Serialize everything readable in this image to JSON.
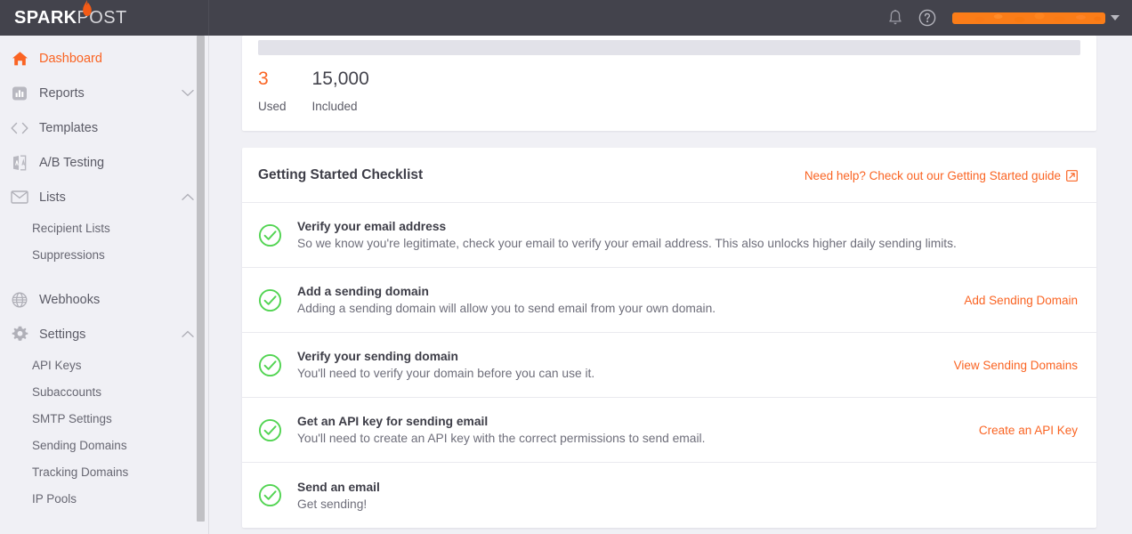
{
  "brand": {
    "logo_spark": "SPARK",
    "logo_post": "POST",
    "accent_color": "#fa6423",
    "topbar_color": "#43434c",
    "success_color": "#52d452"
  },
  "topbar": {
    "notifications_icon": "bell-icon",
    "help_icon": "help-circle-icon",
    "user_name": "",
    "user_caret_icon": "chevron-down-icon"
  },
  "sidebar": {
    "items": [
      {
        "label": "Dashboard",
        "icon": "home-icon",
        "active": true,
        "expandable": false
      },
      {
        "label": "Reports",
        "icon": "bar-chart-icon",
        "active": false,
        "expandable": true,
        "expanded": false
      },
      {
        "label": "Templates",
        "icon": "code-icon",
        "active": false,
        "expandable": false
      },
      {
        "label": "A/B Testing",
        "icon": "ab-test-icon",
        "active": false,
        "expandable": false
      },
      {
        "label": "Lists",
        "icon": "envelope-icon",
        "active": false,
        "expandable": true,
        "expanded": true
      }
    ],
    "lists_children": [
      {
        "label": "Recipient Lists"
      },
      {
        "label": "Suppressions"
      }
    ],
    "items2": [
      {
        "label": "Webhooks",
        "icon": "globe-icon",
        "active": false,
        "expandable": false
      },
      {
        "label": "Settings",
        "icon": "gear-icon",
        "active": false,
        "expandable": true,
        "expanded": true
      }
    ],
    "settings_children": [
      {
        "label": "API Keys"
      },
      {
        "label": "Subaccounts"
      },
      {
        "label": "SMTP Settings"
      },
      {
        "label": "Sending Domains"
      },
      {
        "label": "Tracking Domains"
      },
      {
        "label": "IP Pools"
      }
    ]
  },
  "usage": {
    "used_value": "3",
    "used_label": "Used",
    "included_value": "15,000",
    "included_label": "Included",
    "progress_percent": 0
  },
  "checklist": {
    "title": "Getting Started Checklist",
    "help_link": "Need help? Check out our Getting Started guide",
    "help_icon": "external-link-icon",
    "rows": [
      {
        "title": "Verify your email address",
        "desc": "So we know you're legitimate, check your email to verify your email address. This also unlocks higher daily sending limits.",
        "action": "",
        "status_icon": "check-circle-icon",
        "complete": true
      },
      {
        "title": "Add a sending domain",
        "desc": "Adding a sending domain will allow you to send email from your own domain.",
        "action": "Add Sending Domain",
        "status_icon": "check-circle-icon",
        "complete": true
      },
      {
        "title": "Verify your sending domain",
        "desc": "You'll need to verify your domain before you can use it.",
        "action": "View Sending Domains",
        "status_icon": "check-circle-icon",
        "complete": true
      },
      {
        "title": "Get an API key for sending email",
        "desc": "You'll need to create an API key with the correct permissions to send email.",
        "action": "Create an API Key",
        "status_icon": "check-circle-icon",
        "complete": true
      },
      {
        "title": "Send an email",
        "desc": "Get sending!",
        "action": "",
        "status_icon": "check-circle-icon",
        "complete": true
      }
    ]
  }
}
